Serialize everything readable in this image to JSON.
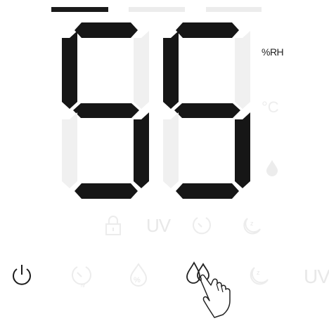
{
  "display": {
    "value": "55",
    "unit_humidity": "%RH",
    "unit_temperature": "°C",
    "mode_indicator_active": 1
  },
  "indicators": {
    "uv_label": "UV"
  },
  "buttons": {
    "uv_label": "UV"
  },
  "colors": {
    "on": "#161616",
    "off": "#f0f0f0"
  }
}
